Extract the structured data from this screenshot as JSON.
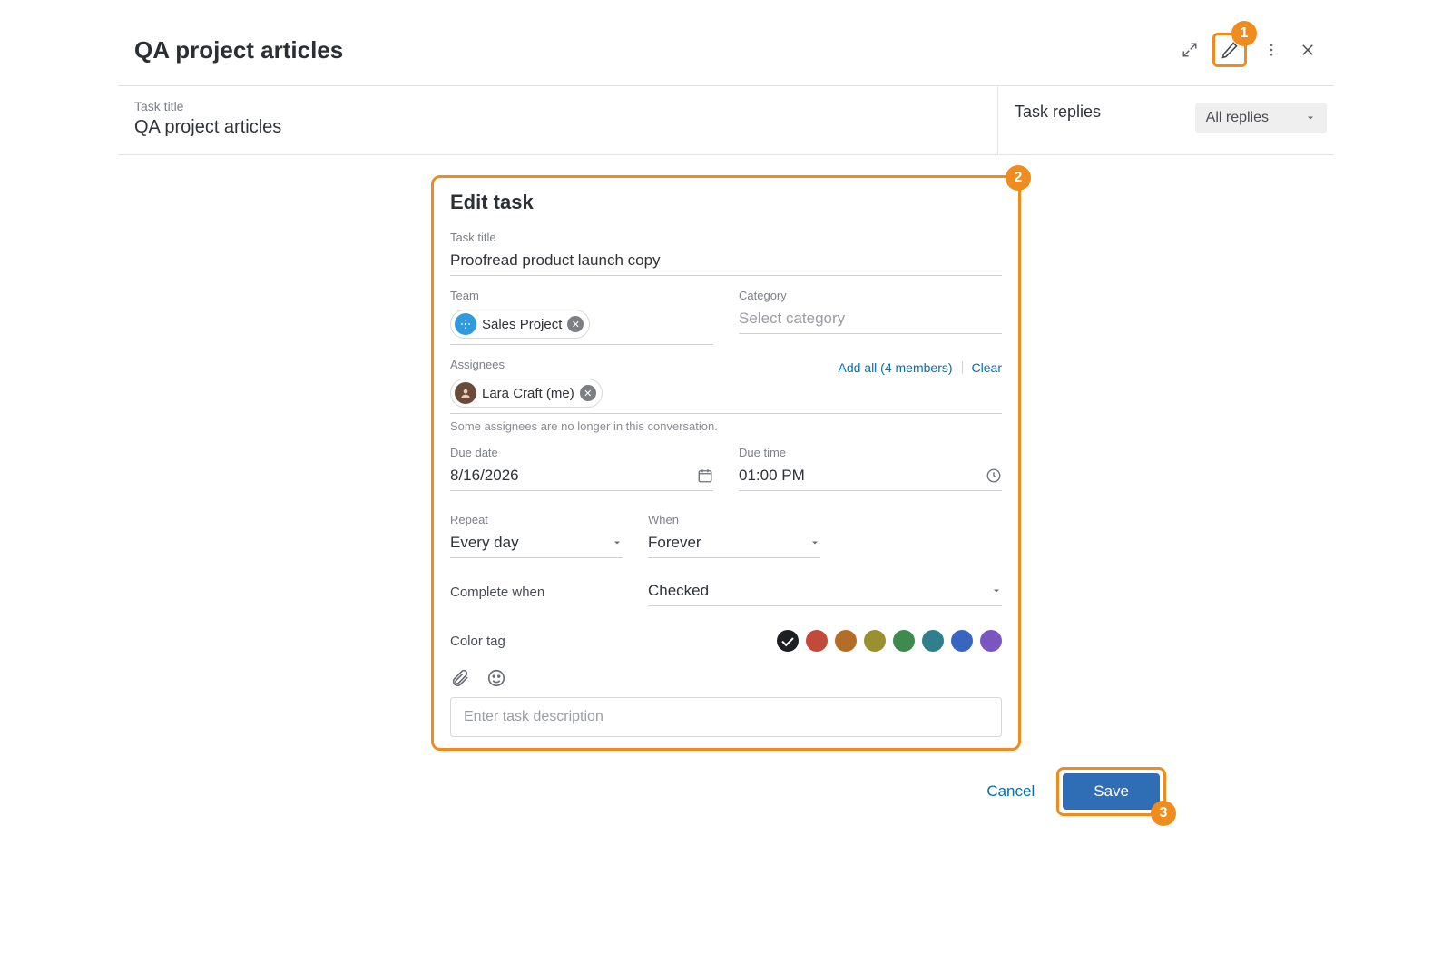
{
  "callouts": {
    "one": "1",
    "two": "2",
    "three": "3"
  },
  "header": {
    "title": "QA project articles"
  },
  "meta": {
    "task_title_label": "Task title",
    "task_title_value": "QA project articles",
    "replies_title": "Task replies",
    "replies_filter": "All replies"
  },
  "edit": {
    "panel_title": "Edit task",
    "task_title_label": "Task title",
    "task_title_value": "Proofread product launch copy",
    "team_label": "Team",
    "team_chip": "Sales Project",
    "category_label": "Category",
    "category_placeholder": "Select category",
    "assignees_label": "Assignees",
    "assignee_chip": "Lara Craft (me)",
    "add_all": "Add all (4 members)",
    "clear": "Clear",
    "assignee_note": "Some assignees are no longer in this conversation.",
    "due_date_label": "Due date",
    "due_date_value": "8/16/2026",
    "due_time_label": "Due time",
    "due_time_value": "01:00 PM",
    "repeat_label": "Repeat",
    "repeat_value": "Every day",
    "when_label": "When",
    "when_value": "Forever",
    "complete_label": "Complete when",
    "complete_value": "Checked",
    "color_label": "Color tag",
    "colors": [
      "#1d1f22",
      "#c24a3a",
      "#b46d26",
      "#99902f",
      "#3f8a4f",
      "#2f7f8d",
      "#3765bf",
      "#7a56c2"
    ],
    "selected_color_index": 0,
    "desc_placeholder": "Enter task description"
  },
  "footer": {
    "cancel": "Cancel",
    "save": "Save"
  }
}
